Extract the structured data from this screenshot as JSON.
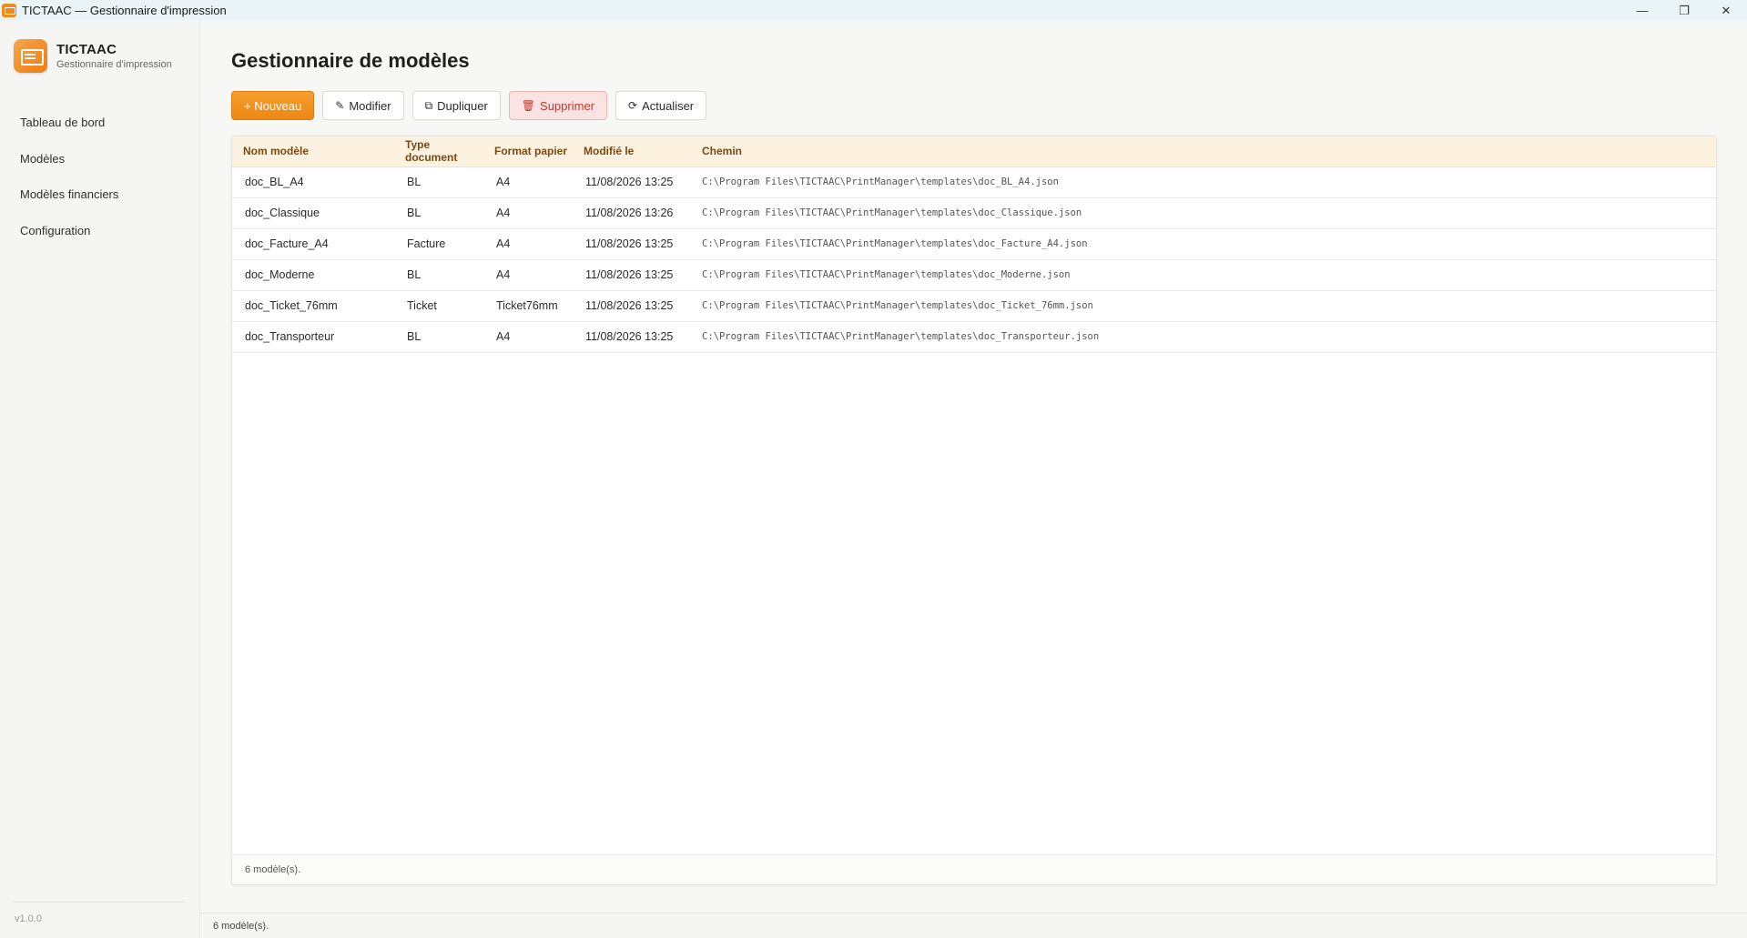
{
  "window": {
    "title": "TICTAAC — Gestionnaire d'impression",
    "icon": "app-printer-icon",
    "controls": {
      "minimize": "—",
      "restore": "❐",
      "close": "✕"
    }
  },
  "brand": {
    "name": "TICTAAC",
    "subtitle": "Gestionnaire d'impression",
    "accent": "#ee8613"
  },
  "nav": [
    {
      "label": "Tableau de bord"
    },
    {
      "label": "Modèles"
    },
    {
      "label": "Modèles financiers"
    },
    {
      "label": "Configuration"
    }
  ],
  "version": "v1.0.0",
  "page": {
    "title": "Gestionnaire de modèles"
  },
  "toolbar": {
    "new_label": "+ Nouveau",
    "edit_label": "Modifier",
    "duplicate_label": "Dupliquer",
    "delete_label": "Supprimer",
    "refresh_label": "Actualiser",
    "icons": {
      "edit": "✎",
      "duplicate": "⧉",
      "delete": "🗑",
      "refresh": "⟳"
    }
  },
  "table": {
    "columns": [
      "Nom modèle",
      "Type document",
      "Format papier",
      "Modifié le",
      "Chemin"
    ],
    "rows": [
      [
        "doc_BL_A4",
        "BL",
        "A4",
        "11/08/2026 13:25",
        "C:\\Program Files\\TICTAAC\\PrintManager\\templates\\doc_BL_A4.json"
      ],
      [
        "doc_Classique",
        "BL",
        "A4",
        "11/08/2026 13:26",
        "C:\\Program Files\\TICTAAC\\PrintManager\\templates\\doc_Classique.json"
      ],
      [
        "doc_Facture_A4",
        "Facture",
        "A4",
        "11/08/2026 13:25",
        "C:\\Program Files\\TICTAAC\\PrintManager\\templates\\doc_Facture_A4.json"
      ],
      [
        "doc_Moderne",
        "BL",
        "A4",
        "11/08/2026 13:25",
        "C:\\Program Files\\TICTAAC\\PrintManager\\templates\\doc_Moderne.json"
      ],
      [
        "doc_Ticket_76mm",
        "Ticket",
        "Ticket76mm",
        "11/08/2026 13:25",
        "C:\\Program Files\\TICTAAC\\PrintManager\\templates\\doc_Ticket_76mm.json"
      ],
      [
        "doc_Transporteur",
        "BL",
        "A4",
        "11/08/2026 13:25",
        "C:\\Program Files\\TICTAAC\\PrintManager\\templates\\doc_Transporteur.json"
      ]
    ],
    "footer": "6 modèle(s)."
  },
  "statusbar": {
    "text": "6 modèle(s)."
  }
}
